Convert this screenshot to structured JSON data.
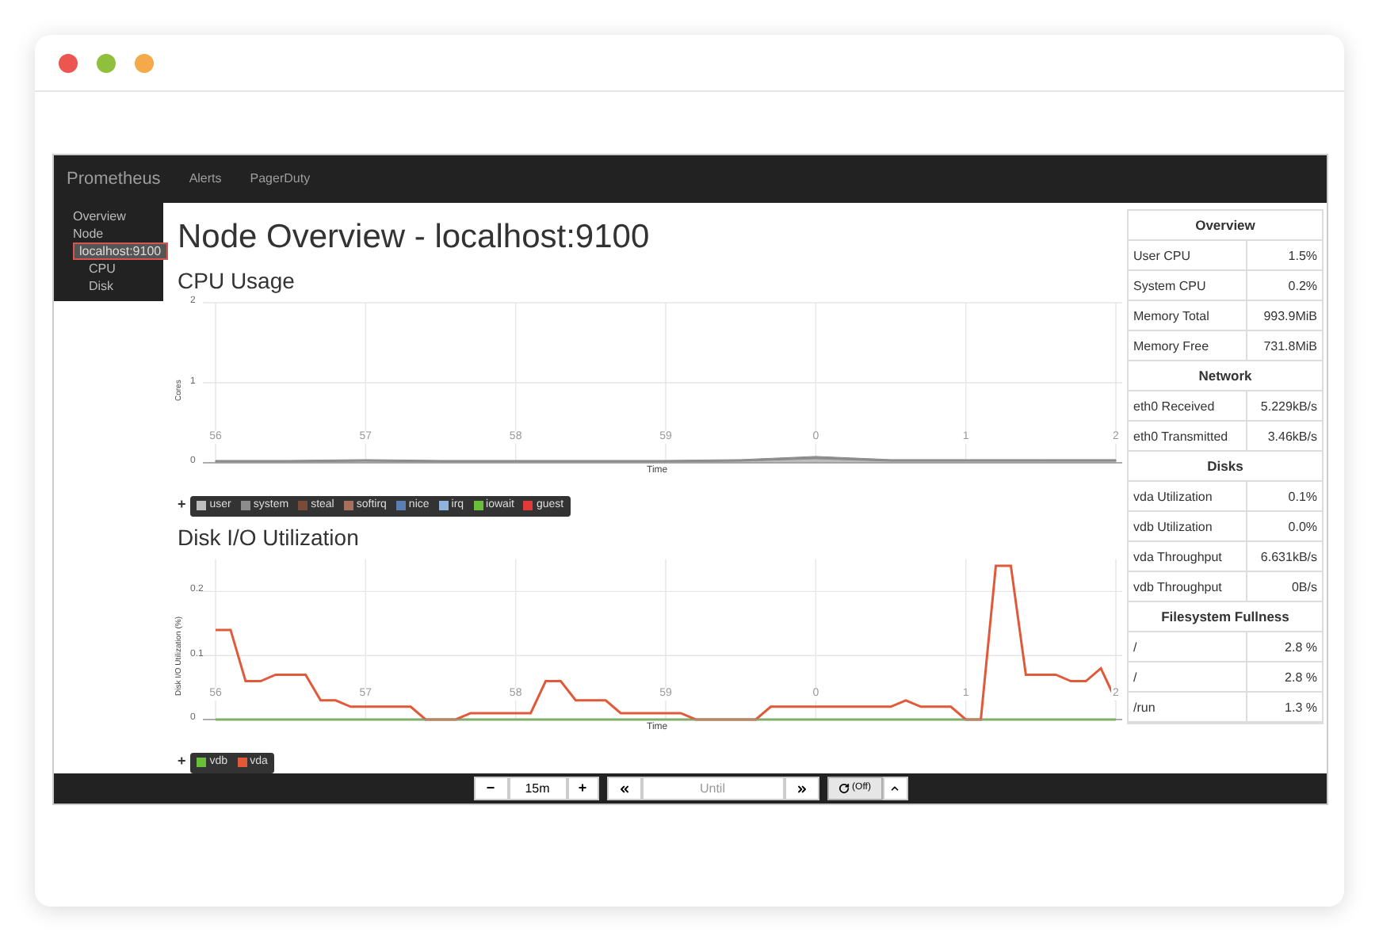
{
  "window": {
    "buttons": [
      {
        "color": "#ec5550"
      },
      {
        "color": "#8fbf3c"
      },
      {
        "color": "#f5a94a"
      }
    ]
  },
  "navbar": {
    "brand": "Prometheus",
    "links": [
      "Alerts",
      "PagerDuty"
    ]
  },
  "sidebar": {
    "items": [
      {
        "label": "Overview",
        "selected": false
      },
      {
        "label": "Node",
        "selected": false,
        "children": [
          {
            "label": "localhost:9100",
            "selected": true,
            "children": [
              {
                "label": "CPU",
                "selected": false
              },
              {
                "label": "Disk",
                "selected": false
              }
            ]
          }
        ]
      }
    ]
  },
  "page_title": "Node Overview - localhost:9100",
  "sections": [
    {
      "title": "CPU Usage",
      "legend_toggle": "+",
      "legend_extra": [
        {
          "name": "steal",
          "color": "#7b4b3a"
        },
        {
          "name": "softirq",
          "color": "#a8705c"
        },
        {
          "name": "nice",
          "color": "#5b7fb3"
        },
        {
          "name": "irq",
          "color": "#8fb3dc"
        },
        {
          "name": "iowait",
          "color": "#6abf3a"
        },
        {
          "name": "guest",
          "color": "#e03a3a"
        }
      ],
      "chart_data": {
        "type": "area",
        "stacked": true,
        "grid": true,
        "xlabel": "Time",
        "ylabel": "Cores",
        "ylim": [
          0,
          2
        ],
        "yticks": [
          0,
          1,
          2
        ],
        "categories": [
          "56",
          null,
          "57",
          null,
          "58",
          null,
          "59",
          null,
          "0",
          null,
          "1",
          null,
          "2"
        ],
        "series": [
          {
            "name": "user",
            "color": "#bdbdbd",
            "values": [
              0.01,
              0.01,
              0.02,
              0.01,
              0.01,
              0.01,
              0.01,
              0.02,
              0.05,
              0.02,
              0.02,
              0.02,
              0.02
            ]
          },
          {
            "name": "system",
            "color": "#8c8c8c",
            "values": [
              0.02,
              0.02,
              0.02,
              0.02,
              0.02,
              0.02,
              0.02,
              0.02,
              0.03,
              0.02,
              0.02,
              0.02,
              0.02
            ]
          }
        ]
      }
    },
    {
      "title": "Disk I/O Utilization",
      "legend_toggle": "+",
      "chart_data": {
        "type": "line",
        "grid": true,
        "xlabel": "Time",
        "ylabel": "Disk I/O Utilization (%)",
        "ylim": [
          0,
          0.25
        ],
        "yticks": [
          0,
          0.1,
          0.2
        ],
        "categories": [
          "56",
          null,
          null,
          null,
          null,
          null,
          null,
          null,
          null,
          null,
          "57",
          null,
          null,
          null,
          null,
          null,
          null,
          null,
          null,
          null,
          "58",
          null,
          null,
          null,
          null,
          null,
          null,
          null,
          null,
          null,
          "59",
          null,
          null,
          null,
          null,
          null,
          null,
          null,
          null,
          null,
          "0",
          null,
          null,
          null,
          null,
          null,
          null,
          null,
          null,
          null,
          "1",
          null,
          null,
          null,
          null,
          null,
          null,
          null,
          null,
          null,
          "2"
        ],
        "series": [
          {
            "name": "vdb",
            "color": "#6abf3a",
            "values": [
              0,
              0,
              0,
              0,
              0,
              0,
              0,
              0,
              0,
              0,
              0,
              0,
              0,
              0,
              0,
              0,
              0,
              0,
              0,
              0,
              0,
              0,
              0,
              0,
              0,
              0,
              0,
              0,
              0,
              0,
              0,
              0,
              0,
              0,
              0,
              0,
              0,
              0,
              0,
              0,
              0,
              0,
              0,
              0,
              0,
              0,
              0,
              0,
              0,
              0,
              0,
              0,
              0,
              0,
              0,
              0,
              0,
              0,
              0,
              0,
              0
            ]
          },
          {
            "name": "vda",
            "color": "#e05a3a",
            "values": [
              0.14,
              0.14,
              0.06,
              0.06,
              0.07,
              0.07,
              0.07,
              0.03,
              0.03,
              0.02,
              0.02,
              0.02,
              0.02,
              0.02,
              0,
              0,
              0,
              0.01,
              0.01,
              0.01,
              0.01,
              0.01,
              0.06,
              0.06,
              0.03,
              0.03,
              0.03,
              0.01,
              0.01,
              0.01,
              0.01,
              0.01,
              0,
              0,
              0,
              0,
              0,
              0.02,
              0.02,
              0.02,
              0.02,
              0.02,
              0.02,
              0.02,
              0.02,
              0.02,
              0.03,
              0.02,
              0.02,
              0.02,
              0,
              0,
              0.24,
              0.24,
              0.07,
              0.07,
              0.07,
              0.06,
              0.06,
              0.08,
              0.03
            ]
          }
        ]
      }
    }
  ],
  "summary": [
    {
      "title": "Overview",
      "rows": [
        {
          "label": "User CPU",
          "value": "1.5%"
        },
        {
          "label": "System CPU",
          "value": "0.2%"
        },
        {
          "label": "Memory Total",
          "value": "993.9MiB"
        },
        {
          "label": "Memory Free",
          "value": "731.8MiB"
        }
      ]
    },
    {
      "title": "Network",
      "rows": [
        {
          "label": "eth0 Received",
          "value": "5.229kB/s"
        },
        {
          "label": "eth0 Transmitted",
          "value": "3.46kB/s"
        }
      ]
    },
    {
      "title": "Disks",
      "rows": [
        {
          "label": "vda Utilization",
          "value": "0.1%"
        },
        {
          "label": "vdb Utilization",
          "value": "0.0%"
        },
        {
          "label": "vda Throughput",
          "value": "6.631kB/s"
        },
        {
          "label": "vdb Throughput",
          "value": "0B/s"
        }
      ]
    },
    {
      "title": "Filesystem Fullness",
      "rows": [
        {
          "label": "/",
          "value": "2.8 %"
        },
        {
          "label": "/",
          "value": "2.8 %"
        },
        {
          "label": "/run",
          "value": "1.3 %"
        }
      ]
    }
  ],
  "controls": {
    "minus": "−",
    "range": "15m",
    "plus": "+",
    "until_placeholder": "Until",
    "refresh": "(Off)"
  }
}
